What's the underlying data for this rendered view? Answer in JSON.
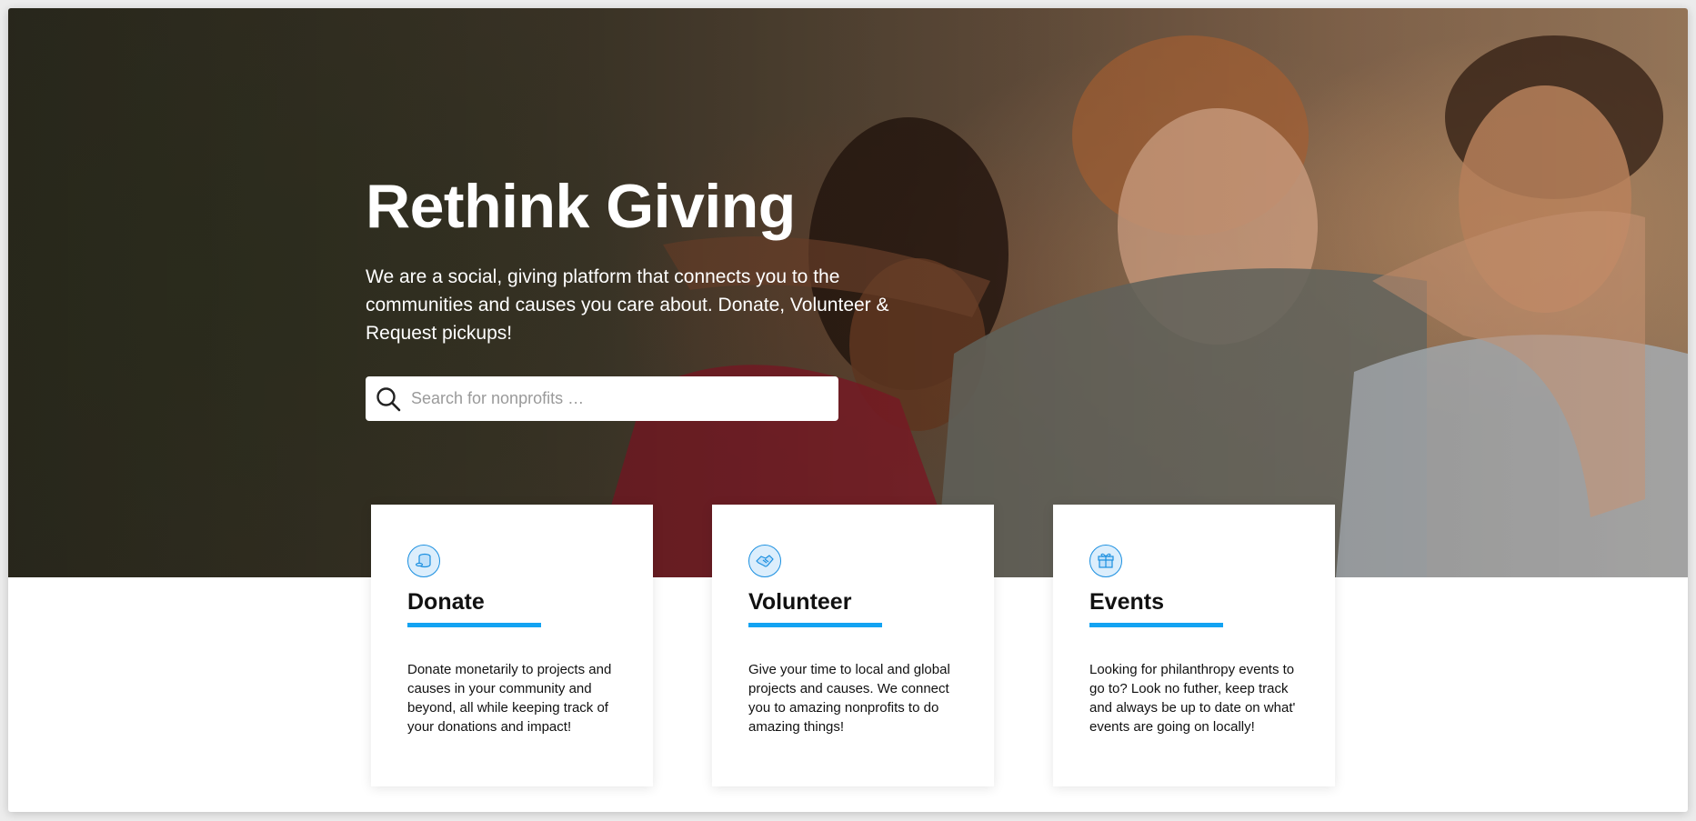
{
  "hero": {
    "title": "Rethink Giving",
    "subtitle": "We are a social, giving platform that connects you to the communities and causes you care about. Donate, Volunteer & Request pickups!",
    "background_image": "three-women-laughing-outdoors-photo"
  },
  "search": {
    "placeholder": "Search for nonprofits …",
    "value": "",
    "icon": "search-icon"
  },
  "cards": [
    {
      "icon": "coins-icon",
      "title": "Donate",
      "text": "Donate monetarily to projects and causes in your community and beyond, all while keeping track of your donations and impact!"
    },
    {
      "icon": "handshake-icon",
      "title": "Volunteer",
      "text": "Give your time to local and global projects and causes. We connect you to amazing nonprofits to do amazing things!"
    },
    {
      "icon": "gift-icon",
      "title": "Events",
      "text": "Looking for philanthropy events to go to? Look no futher, keep track and always be up to date on what' events are going on locally!"
    }
  ],
  "colors": {
    "accent": "#13a3f2",
    "icon_bg": "#dceefc",
    "icon_stroke": "#1a8fe0"
  }
}
